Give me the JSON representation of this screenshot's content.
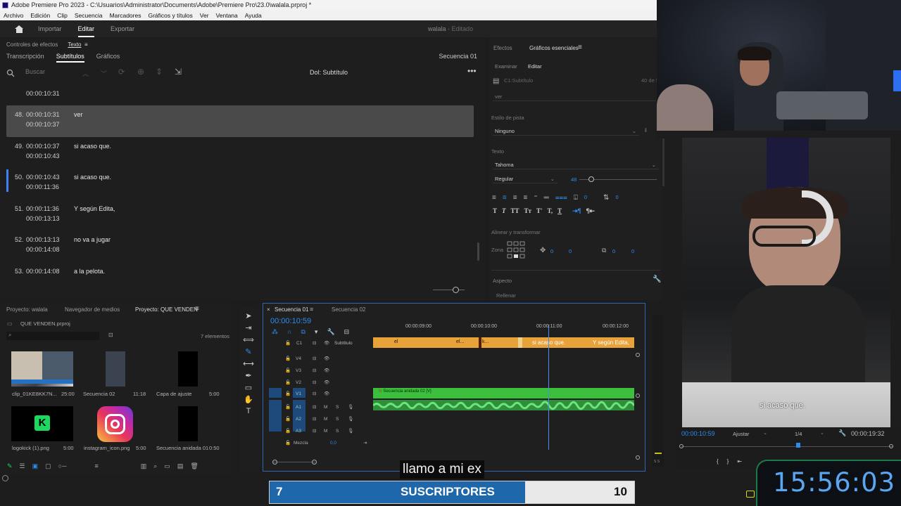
{
  "window": {
    "title": "Adobe Premiere Pro 2023 - C:\\Usuarios\\Administrator\\Documents\\Adobe\\Premiere Pro\\23.0\\walala.prproj *"
  },
  "menu": [
    "Archivo",
    "Edición",
    "Clip",
    "Secuencia",
    "Marcadores",
    "Gráficos y títulos",
    "Ver",
    "Ventana",
    "Ayuda"
  ],
  "header": {
    "modes": [
      "Importar",
      "Editar",
      "Exportar"
    ],
    "active_mode": "Editar",
    "project_name": "walala",
    "project_status": "Editado"
  },
  "text_panel": {
    "tabs": [
      "Controles de efectos",
      "Texto"
    ],
    "subtabs": [
      "Transcripción",
      "Subtítulos",
      "Gráficos"
    ],
    "sequence": "Secuencia 01",
    "search_placeholder": "Buscar",
    "track_label": "Dol: Subtítulo",
    "top_partial_time": "00:00:10:31",
    "rows": [
      {
        "num": "48.",
        "in": "00:00:10:31",
        "out": "00:00:10:37",
        "text": "ver"
      },
      {
        "num": "49.",
        "in": "00:00:10:37",
        "out": "00:00:10:43",
        "text": "si acaso que."
      },
      {
        "num": "50.",
        "in": "00:00:10:43",
        "out": "00:00:11:36",
        "text": "si acaso que."
      },
      {
        "num": "51.",
        "in": "00:00:11:36",
        "out": "00:00:13:13",
        "text": "Y según Edita,"
      },
      {
        "num": "52.",
        "in": "00:00:13:13",
        "out": "00:00:14:08",
        "text": "no va a jugar"
      },
      {
        "num": "53.",
        "in": "00:00:14:08",
        "out": "",
        "text": "a la pelota."
      }
    ]
  },
  "essential_graphics": {
    "tabs": [
      "Efectos",
      "Gráficos esenciales"
    ],
    "subtabs": [
      "Examinar",
      "Editar"
    ],
    "layer": "C1:Subtítulo",
    "layer_num": "40 de 5",
    "text_value": "ver",
    "track_style_label": "Estilo de pista",
    "track_style_value": "Ninguno",
    "text_label": "Texto",
    "font": "Tahoma",
    "font_style": "Regular",
    "font_size": "48",
    "align_label": "Alinear y transformar",
    "zone_label": "Zona",
    "zeros": [
      "0",
      "0",
      "0",
      "0",
      "0",
      "0"
    ],
    "appearance_label": "Aspecto",
    "fill_label": "Rellenar"
  },
  "project": {
    "tabs": [
      "Proyecto: walala",
      "Navegador de medios",
      "Proyecto: QUE VENDEN"
    ],
    "bin": "QUE VENDEN.prproj",
    "count": "7 elementos",
    "items": [
      {
        "name": "clip_01KE8KK7N...",
        "dur": "25:00"
      },
      {
        "name": "Secuencia 02",
        "dur": "11:18"
      },
      {
        "name": "Capa de ajuste",
        "dur": "5:00"
      },
      {
        "name": "logokick (1).png",
        "dur": "5:00"
      },
      {
        "name": "instagram_icon.png",
        "dur": "5:00"
      },
      {
        "name": "Secuencia anidada 01",
        "dur": "0:50"
      }
    ]
  },
  "timeline": {
    "tabs": [
      "Secuencia 01",
      "Secuencia 02"
    ],
    "timecode": "00:00:10:59",
    "ruler": [
      "00:00:09:00",
      "00:00:10:00",
      "00:00:11:00",
      "00:00:12:00"
    ],
    "subtitle_track": "Subtítulo",
    "subtitle_clips": [
      "el",
      "el...",
      "k...",
      "si acaso que.",
      "Y según Edita,"
    ],
    "video_tracks": [
      "V4",
      "V3",
      "V2",
      "V1"
    ],
    "audio_tracks": [
      "A1",
      "A2",
      "A3"
    ],
    "nested_clip": "Secuencia anidada 02 [V]",
    "mix_label": "Mezcla",
    "mix_value": "0,0"
  },
  "monitor": {
    "caption": "si acaso que.",
    "timecode": "00:00:10:59",
    "fit": "Ajustar",
    "ratio": "1/4",
    "duration": "00:00:19:32"
  },
  "overlay": {
    "subtitle": "llamo a mi ex",
    "subs_current": "7",
    "subs_label": "SUSCRIPTORES",
    "subs_goal": "10",
    "subs_progress": 0.7,
    "clock": "15:56:03",
    "meter_label": "S S"
  },
  "colors": {
    "accent": "#2d8ceb",
    "subtitle_clip": "#e8a23a",
    "video_clip": "#3cbf3c",
    "audio_clip": "#2f8f3a",
    "sub_bar": "#1f67ab",
    "clock_text": "#5aa6f0"
  }
}
